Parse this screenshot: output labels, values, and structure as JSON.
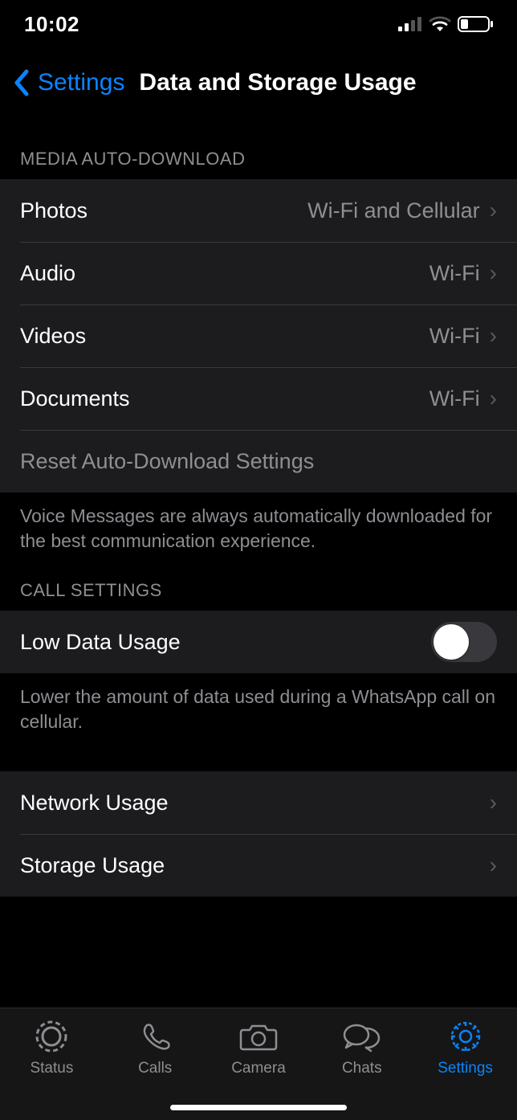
{
  "status_bar": {
    "time": "10:02"
  },
  "nav": {
    "back": "Settings",
    "title": "Data and Storage Usage"
  },
  "media_section": {
    "header": "MEDIA AUTO-DOWNLOAD",
    "rows": [
      {
        "label": "Photos",
        "value": "Wi-Fi and Cellular"
      },
      {
        "label": "Audio",
        "value": "Wi-Fi"
      },
      {
        "label": "Videos",
        "value": "Wi-Fi"
      },
      {
        "label": "Documents",
        "value": "Wi-Fi"
      }
    ],
    "reset": "Reset Auto-Download Settings",
    "footer": "Voice Messages are always automatically downloaded for the best communication experience."
  },
  "call_section": {
    "header": "CALL SETTINGS",
    "low_data": "Low Data Usage",
    "footer": "Lower the amount of data used during a WhatsApp call on cellular."
  },
  "usage_section": {
    "rows": [
      {
        "label": "Network Usage"
      },
      {
        "label": "Storage Usage"
      }
    ]
  },
  "tabs": [
    {
      "label": "Status"
    },
    {
      "label": "Calls"
    },
    {
      "label": "Camera"
    },
    {
      "label": "Chats"
    },
    {
      "label": "Settings"
    }
  ]
}
